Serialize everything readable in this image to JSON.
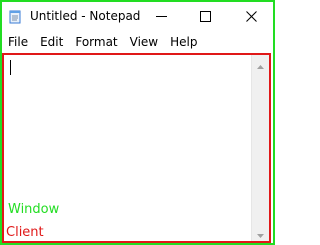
{
  "window": {
    "title": "Untitled - Notepad",
    "icon": "notepad-icon",
    "border_color": "#22dd22"
  },
  "caption_buttons": {
    "minimize_icon": "minimize-icon",
    "maximize_icon": "maximize-icon",
    "close_icon": "close-icon"
  },
  "menu": {
    "items": [
      {
        "label": "File"
      },
      {
        "label": "Edit"
      },
      {
        "label": "Format"
      },
      {
        "label": "View"
      },
      {
        "label": "Help"
      }
    ]
  },
  "client": {
    "text": "",
    "border_color": "#e01818"
  },
  "annotations": {
    "window_label": "Window",
    "client_label": "Client"
  }
}
